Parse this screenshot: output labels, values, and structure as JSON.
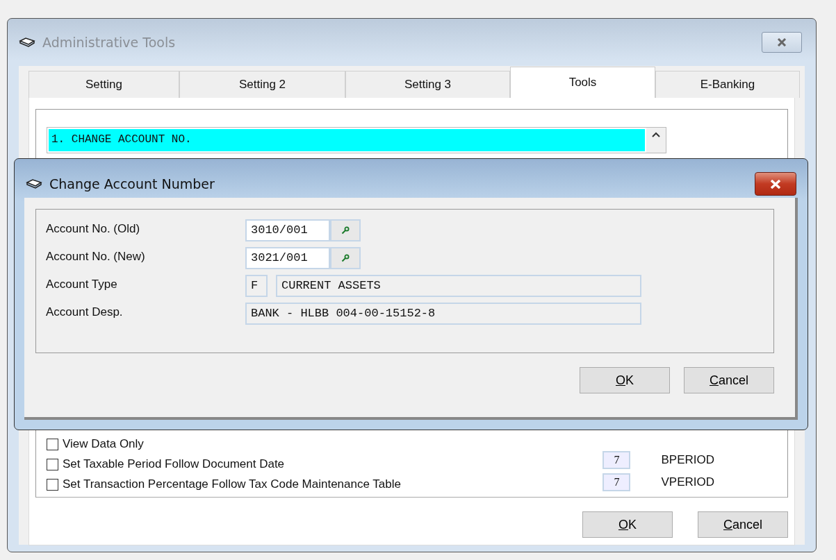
{
  "window": {
    "title": "Administrative Tools"
  },
  "tabs": [
    {
      "label": "Setting",
      "selected": false
    },
    {
      "label": "Setting 2",
      "selected": false
    },
    {
      "label": "Setting 3",
      "selected": false
    },
    {
      "label": "Tools",
      "selected": true
    },
    {
      "label": "E-Banking",
      "selected": false
    }
  ],
  "tool_list": {
    "items": [
      {
        "label": "1. CHANGE ACCOUNT NO.",
        "selected": true
      }
    ]
  },
  "options": [
    {
      "label": "View Data Only",
      "checked": false
    },
    {
      "label": "Set Taxable Period Follow Document Date",
      "checked": false
    },
    {
      "label": "Set Transaction Percentage Follow Tax Code Maintenance Table",
      "checked": false
    }
  ],
  "periods": [
    {
      "value": "7",
      "label": "BPERIOD"
    },
    {
      "value": "7",
      "label": "VPERIOD"
    }
  ],
  "buttons": [
    "OK",
    "Cancel"
  ],
  "dialog": {
    "title": "Change Account Number",
    "fields": [
      {
        "label": "Account No. (Old)",
        "kind": "lookup",
        "value": "3010/001",
        "editable": true
      },
      {
        "label": "Account No. (New)",
        "kind": "lookup",
        "value": "3021/001",
        "editable": true
      },
      {
        "label": "Account Type",
        "kind": "code",
        "code": "F",
        "value": "CURRENT ASSETS",
        "editable": false
      },
      {
        "label": "Account Desp.",
        "kind": "text",
        "value": "BANK - HLBB 004-00-15152-8",
        "editable": false
      }
    ],
    "buttons": [
      "OK",
      "Cancel"
    ]
  }
}
